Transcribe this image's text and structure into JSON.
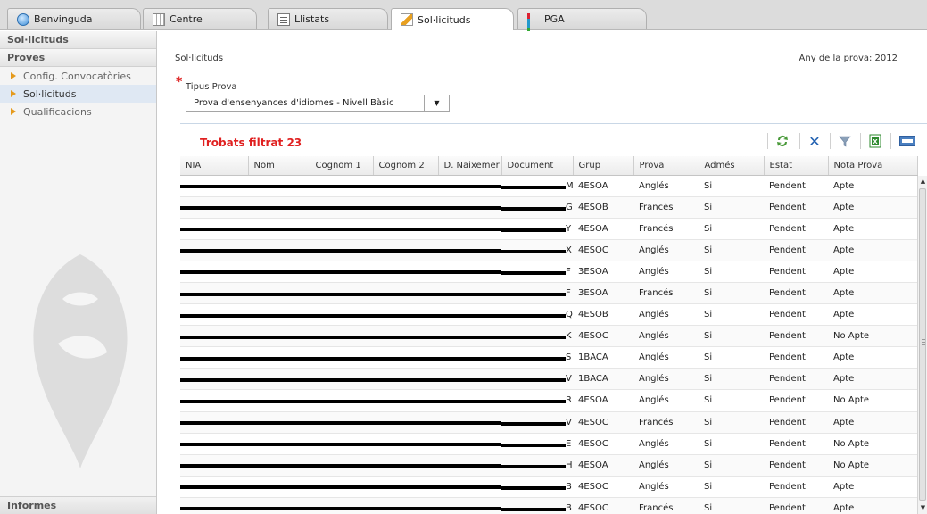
{
  "tabs": [
    {
      "label": "Benvinguda",
      "icon": "globe-icon"
    },
    {
      "label": "Centre",
      "icon": "grid-icon"
    },
    {
      "label": "Llistats",
      "icon": "list-icon"
    },
    {
      "label": "Sol·licituds",
      "icon": "pencil-icon"
    },
    {
      "label": "PGA",
      "icon": "bar-chart-icon"
    }
  ],
  "sidebar": {
    "header1": "Sol·licituds",
    "header2": "Proves",
    "items": [
      "Config. Convocatòries",
      "Sol·licituds",
      "Qualificacions"
    ],
    "footer": "Informes"
  },
  "main": {
    "title": "Sol·licituds",
    "year": "Any de la prova: 2012",
    "required_mark": "*",
    "field_label": "Tipus Prova",
    "select_value": "Prova d'ensenyances d'idiomes - Nivell Bàsic",
    "arrow": "▼"
  },
  "grid": {
    "found_label": "Trobats filtrat 23",
    "toolbar_colors": {
      "refresh": "#4a9a3a",
      "delete": "#1f5fb0",
      "filter": "#8aa0b8",
      "excel": "#2e8a2e",
      "html": "#4a7fc0"
    },
    "columns": [
      "NIA",
      "Nom",
      "Cognom 1",
      "Cognom 2",
      "D. Naixemer",
      "Document",
      "Grup",
      "Prova",
      "Admés",
      "Estat",
      "Nota Prova"
    ],
    "doc_suffix": [
      "M",
      "G",
      "Y",
      "X",
      "F",
      "F",
      "Q",
      "K",
      "S",
      "V",
      "R",
      "V",
      "E",
      "H",
      "B",
      "B"
    ],
    "rows": [
      {
        "grup": "4ESOA",
        "prova": "Anglés",
        "admes": "Si",
        "estat": "Pendent",
        "nota": "Apte"
      },
      {
        "grup": "4ESOB",
        "prova": "Francés",
        "admes": "Si",
        "estat": "Pendent",
        "nota": "Apte"
      },
      {
        "grup": "4ESOA",
        "prova": "Francés",
        "admes": "Si",
        "estat": "Pendent",
        "nota": "Apte"
      },
      {
        "grup": "4ESOC",
        "prova": "Anglés",
        "admes": "Si",
        "estat": "Pendent",
        "nota": "Apte"
      },
      {
        "grup": "3ESOA",
        "prova": "Anglés",
        "admes": "Si",
        "estat": "Pendent",
        "nota": "Apte"
      },
      {
        "grup": "3ESOA",
        "prova": "Francés",
        "admes": "Si",
        "estat": "Pendent",
        "nota": "Apte"
      },
      {
        "grup": "4ESOB",
        "prova": "Anglés",
        "admes": "Si",
        "estat": "Pendent",
        "nota": "Apte"
      },
      {
        "grup": "4ESOC",
        "prova": "Anglés",
        "admes": "Si",
        "estat": "Pendent",
        "nota": "No Apte"
      },
      {
        "grup": "1BACA",
        "prova": "Anglés",
        "admes": "Si",
        "estat": "Pendent",
        "nota": "Apte"
      },
      {
        "grup": "1BACA",
        "prova": "Anglés",
        "admes": "Si",
        "estat": "Pendent",
        "nota": "Apte"
      },
      {
        "grup": "4ESOA",
        "prova": "Anglés",
        "admes": "Si",
        "estat": "Pendent",
        "nota": "No Apte"
      },
      {
        "grup": "4ESOC",
        "prova": "Francés",
        "admes": "Si",
        "estat": "Pendent",
        "nota": "Apte"
      },
      {
        "grup": "4ESOC",
        "prova": "Anglés",
        "admes": "Si",
        "estat": "Pendent",
        "nota": "No Apte"
      },
      {
        "grup": "4ESOA",
        "prova": "Anglés",
        "admes": "Si",
        "estat": "Pendent",
        "nota": "No Apte"
      },
      {
        "grup": "4ESOC",
        "prova": "Anglés",
        "admes": "Si",
        "estat": "Pendent",
        "nota": "Apte"
      },
      {
        "grup": "4ESOC",
        "prova": "Francés",
        "admes": "Si",
        "estat": "Pendent",
        "nota": "Apte"
      }
    ]
  }
}
